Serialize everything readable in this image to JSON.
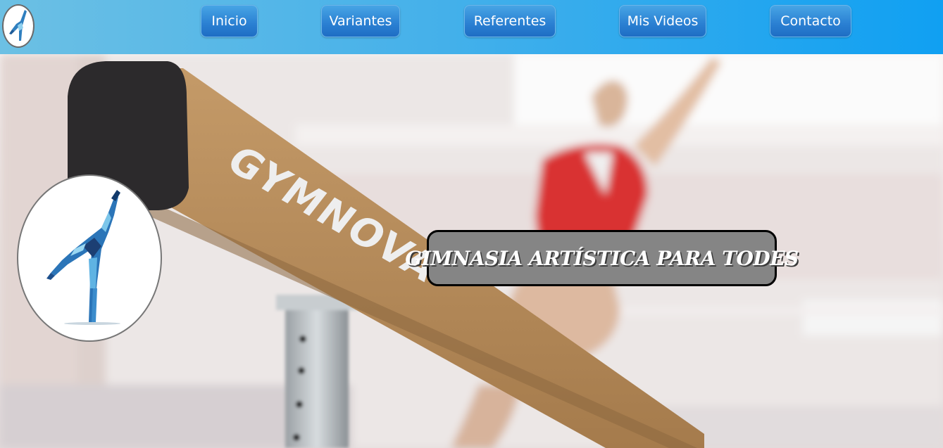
{
  "nav": {
    "items": [
      {
        "label": "Inicio"
      },
      {
        "label": "Variantes"
      },
      {
        "label": "Referentes"
      },
      {
        "label": "Mis Videos"
      },
      {
        "label": "Contacto"
      }
    ]
  },
  "hero": {
    "beam_brand": "GYMNOVA",
    "banner_text": "GIMNASIA ARTÍSTICA PARA TODES"
  },
  "colors": {
    "header_gradient_start": "#6cc0e4",
    "header_gradient_end": "#10a0f2",
    "nav_button": "#2a7fd2",
    "banner_bg": "#858585",
    "leotard": "#d93030",
    "beam": "#b98e5c"
  },
  "icons": {
    "header_logo": "gymnast-logo-icon",
    "hero_logo": "gymnast-logo-icon"
  }
}
